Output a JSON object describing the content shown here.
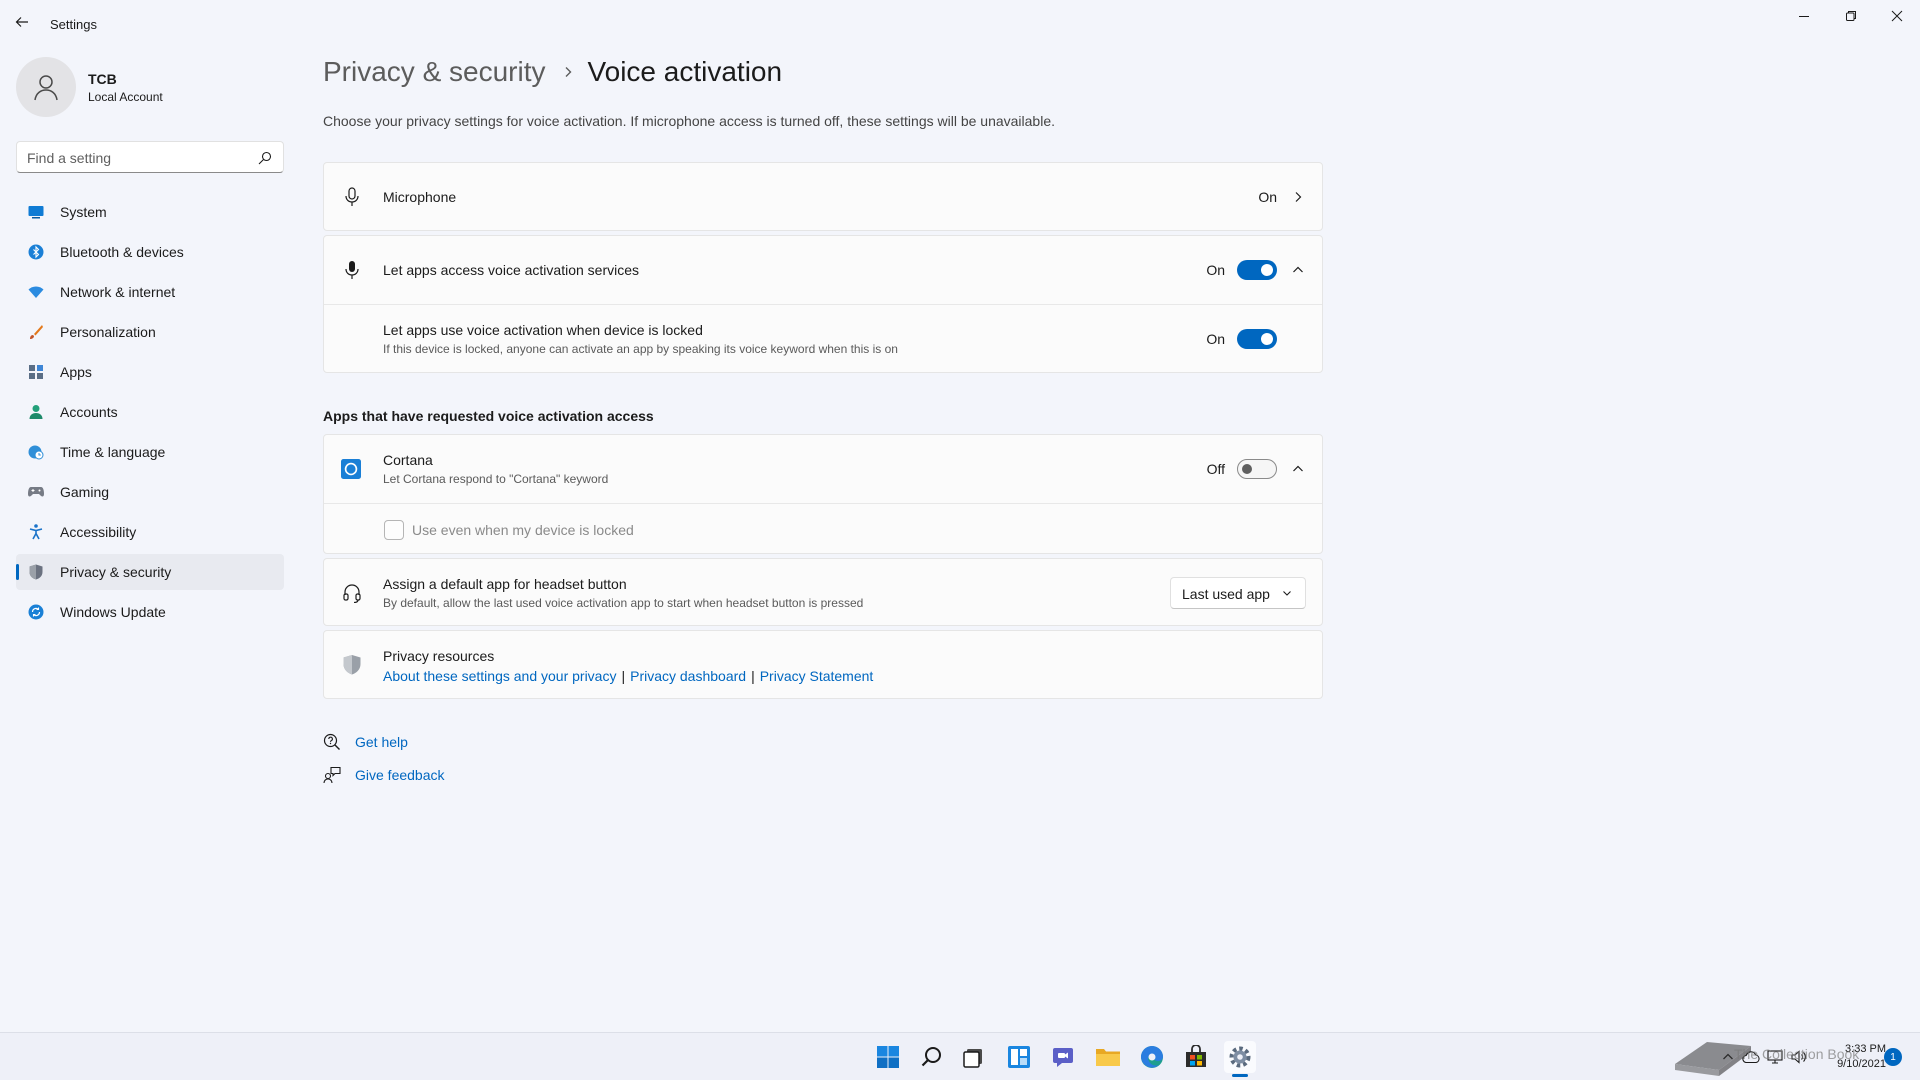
{
  "window": {
    "title": "Settings"
  },
  "profile": {
    "name": "TCB",
    "account_type": "Local Account"
  },
  "search": {
    "placeholder": "Find a setting"
  },
  "sidebar": {
    "items": [
      {
        "label": "System",
        "icon": "monitor-icon"
      },
      {
        "label": "Bluetooth & devices",
        "icon": "bluetooth-icon"
      },
      {
        "label": "Network & internet",
        "icon": "wifi-icon"
      },
      {
        "label": "Personalization",
        "icon": "brush-icon"
      },
      {
        "label": "Apps",
        "icon": "apps-icon"
      },
      {
        "label": "Accounts",
        "icon": "person-icon"
      },
      {
        "label": "Time & language",
        "icon": "globe-clock-icon"
      },
      {
        "label": "Gaming",
        "icon": "gamepad-icon"
      },
      {
        "label": "Accessibility",
        "icon": "accessibility-icon"
      },
      {
        "label": "Privacy & security",
        "icon": "shield-icon",
        "active": true
      },
      {
        "label": "Windows Update",
        "icon": "update-icon"
      }
    ]
  },
  "breadcrumb": {
    "parent": "Privacy & security",
    "current": "Voice activation"
  },
  "description": "Choose your privacy settings for voice activation. If microphone access is turned off, these settings will be unavailable.",
  "microphone_row": {
    "title": "Microphone",
    "state": "On"
  },
  "voice_access": {
    "title": "Let apps access voice activation services",
    "state": "On",
    "locked": {
      "title": "Let apps use voice activation when device is locked",
      "subtitle": "If this device is locked, anyone can activate an app by speaking its voice keyword when this is on",
      "state": "On"
    }
  },
  "apps_section": {
    "heading": "Apps that have requested voice activation access",
    "cortana": {
      "title": "Cortana",
      "subtitle": "Let Cortana respond to \"Cortana\" keyword",
      "state": "Off",
      "checkbox_label": "Use even when my device is locked"
    }
  },
  "headset": {
    "title": "Assign a default app for headset button",
    "subtitle": "By default, allow the last used voice activation app to start when headset button is pressed",
    "selected": "Last used app"
  },
  "privacy_resources": {
    "title": "Privacy resources",
    "links": [
      "About these settings and your privacy",
      "Privacy dashboard",
      "Privacy Statement"
    ]
  },
  "help": {
    "get_help": "Get help",
    "give_feedback": "Give feedback"
  },
  "taskbar": {
    "time": "3:33 PM",
    "date": "9/10/2021",
    "notification_count": "1"
  },
  "watermark": "The Collection Book",
  "colors": {
    "accent": "#0067c0",
    "background": "#f3f5fb",
    "card": "#fbfbfb"
  }
}
